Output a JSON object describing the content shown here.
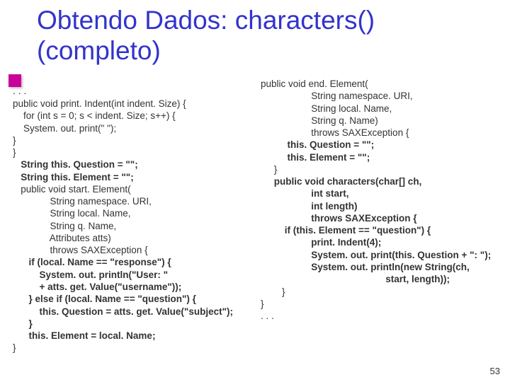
{
  "title": "Obtendo Dados: characters()\n(completo)",
  "ellipsis_left": ". . .",
  "left": {
    "l01": "public void print. Indent(int indent. Size) {",
    "l02": "    for (int s = 0; s < indent. Size; s++) {",
    "l03": "    System. out. print(\" \");",
    "l04": "}",
    "l05": "}",
    "b01": "   String this. Question = \"\";",
    "b02": "   String this. Element = \"\";",
    "l06": "   public void start. Element(",
    "l07": "              String namespace. URI,",
    "l08": "              String local. Name,",
    "l09": "              String q. Name,",
    "l10": "              Attributes atts)",
    "l11": "              throws SAXException {",
    "b03": "      if (local. Name == \"response\") {",
    "b04": "          System. out. println(\"User: \"",
    "b05": "          + atts. get. Value(\"username\"));",
    "b06": "      } else if (local. Name == \"question\") {",
    "b07": "          this. Question = atts. get. Value(\"subject\");",
    "b08": "      }",
    "b09": "      this. Element = local. Name;",
    "l12": "}"
  },
  "right": {
    "r01": "public void end. Element(",
    "r02": "                   String namespace. URI,",
    "r03": "                   String local. Name,",
    "r04": "                   String q. Name)",
    "r05": "                   throws SAXException {",
    "rb01": "          this. Question = \"\";",
    "rb02": "          this. Element = \"\";",
    "r06": "     }",
    "rb03": "     public void characters(char[] ch,",
    "rb04": "                   int start,",
    "rb05": "                   int length)",
    "rb06": "                   throws SAXException {",
    "rb07": "         if (this. Element == \"question\") {",
    "rb08": "                   print. Indent(4);",
    "rb09": "                   System. out. print(this. Question + \": \");",
    "rb10": "                   System. out. println(new String(ch,",
    "rb11": "                                               start, length));",
    "r07": "        }",
    "r08": "}",
    "r09": ". . ."
  },
  "page_number": "53"
}
